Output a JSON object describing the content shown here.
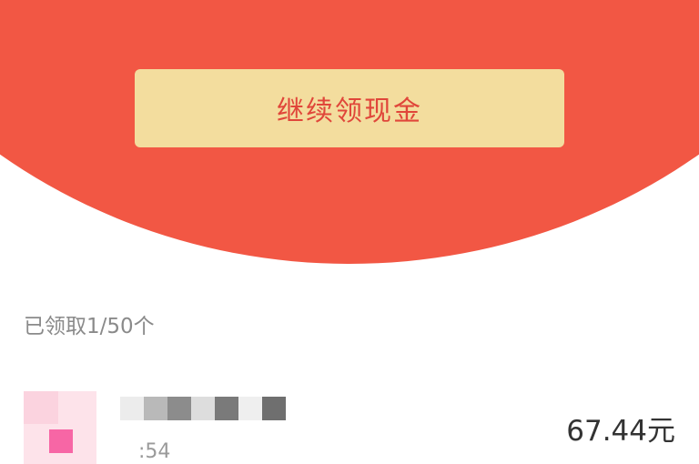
{
  "header": {
    "button_label": "继续领现金"
  },
  "claimed": {
    "text": "已领取1/50个"
  },
  "list": {
    "items": [
      {
        "time": ":54",
        "amount": "67.44元"
      }
    ]
  },
  "colors": {
    "header_red": "#f25744",
    "button_bg": "#f3dd9e",
    "button_text": "#e0463a",
    "muted_text": "#8a8a8a",
    "amount_text": "#333333"
  }
}
